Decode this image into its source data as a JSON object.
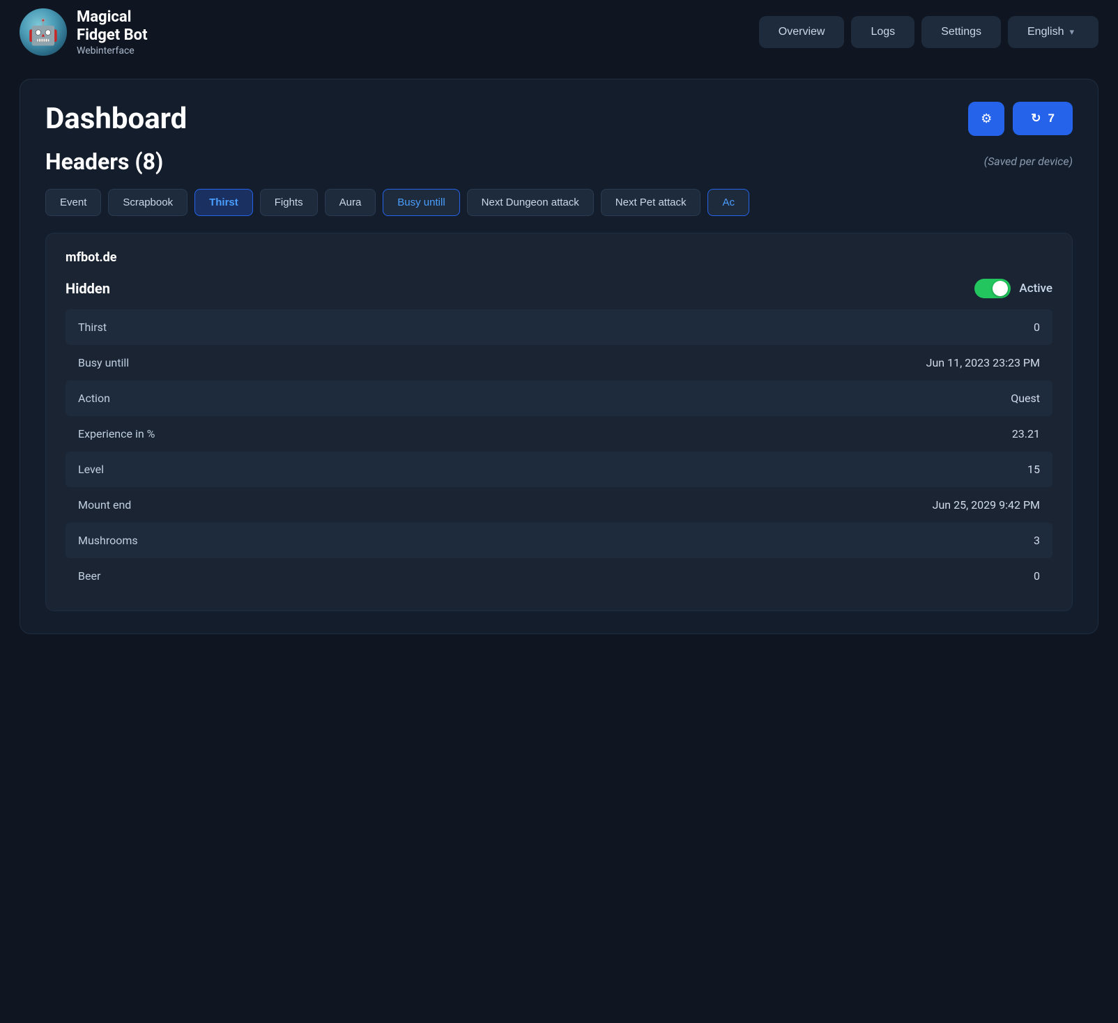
{
  "brand": {
    "title": "Magical\nFidget Bot",
    "subtitle": "Webinterface"
  },
  "nav": {
    "overview": "Overview",
    "logs": "Logs",
    "settings": "Settings",
    "language": "English"
  },
  "dashboard": {
    "title": "Dashboard",
    "gear_icon": "⚙",
    "refresh_icon": "↻",
    "refresh_count": "7"
  },
  "headers_section": {
    "title": "Headers (8)",
    "meta": "(Saved per device)"
  },
  "tabs": [
    {
      "label": "Event",
      "active": false
    },
    {
      "label": "Scrapbook",
      "active": false
    },
    {
      "label": "Thirst",
      "active": true
    },
    {
      "label": "Fights",
      "active": false
    },
    {
      "label": "Aura",
      "active": false
    },
    {
      "label": "Busy untill",
      "active": true
    },
    {
      "label": "Next Dungeon attack",
      "active": false
    },
    {
      "label": "Next Pet attack",
      "active": false
    },
    {
      "label": "Ac",
      "active": false
    }
  ],
  "device_card": {
    "name": "mfbot.de",
    "hidden_label": "Hidden",
    "toggle_active": true,
    "active_label": "Active"
  },
  "data_rows": [
    {
      "label": "Thirst",
      "value": "0"
    },
    {
      "label": "Busy untill",
      "value": "Jun 11, 2023 23:23 PM"
    },
    {
      "label": "Action",
      "value": "Quest"
    },
    {
      "label": "Experience in %",
      "value": "23.21"
    },
    {
      "label": "Level",
      "value": "15"
    },
    {
      "label": "Mount end",
      "value": "Jun 25, 2029 9:42 PM"
    },
    {
      "label": "Mushrooms",
      "value": "3"
    },
    {
      "label": "Beer",
      "value": "0"
    }
  ]
}
